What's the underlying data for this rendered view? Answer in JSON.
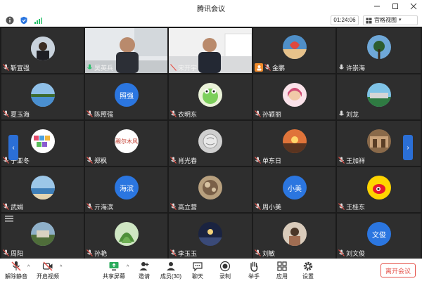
{
  "window": {
    "title": "腾讯会议"
  },
  "infobar": {
    "timer": "01:24:06",
    "view_label": "宫格视图"
  },
  "grid": {
    "prev_label": "‹",
    "next_label": "›",
    "row1": [
      "靳宣强",
      "吴英兵",
      "宋开宇",
      "金鹏",
      "许崇海"
    ],
    "row2": [
      "夏玉海",
      "陈照强",
      "衣明东",
      "孙颖丽",
      "刘龙"
    ],
    "row3": [
      "于亚冬",
      "郑枫",
      "肖光春",
      "单东日",
      "王加祥"
    ],
    "row4": [
      "武娟",
      "亓海滨",
      "高立营",
      "周小美",
      "王桂东"
    ],
    "row5": [
      "周阳",
      "孙艳",
      "李玉玉",
      "刘敏",
      "刘文俊"
    ],
    "avatar_texts": {
      "chen": "照强",
      "zheng": "觋尔木风",
      "qi": "海滨",
      "zhou": "小美",
      "liuwj": "文俊"
    }
  },
  "toolbar": {
    "unmute": "解除静音",
    "video": "开启视频",
    "share": "共享屏幕",
    "invite": "邀请",
    "members": "成员(30)",
    "chat": "聊天",
    "record": "录制",
    "raise": "举手",
    "apps": "应用",
    "settings": "设置",
    "leave": "离开会议"
  },
  "colors": {
    "accent": "#2b76e0",
    "active_border": "#27c06a",
    "leave": "#e5534b",
    "tile_bg": "#2e2e2e"
  }
}
